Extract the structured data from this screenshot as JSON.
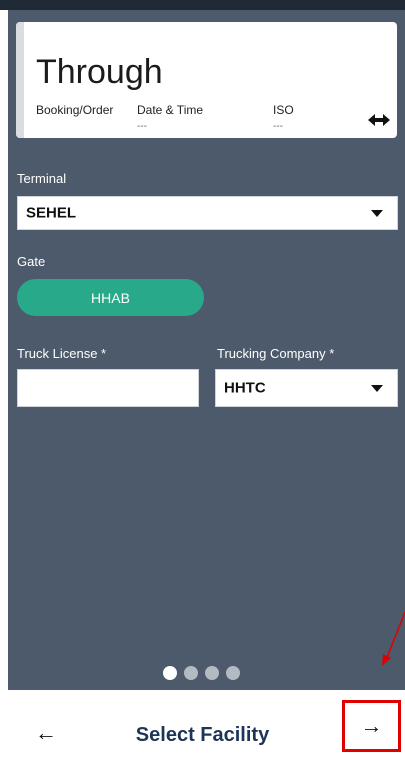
{
  "card": {
    "title": "Through",
    "columns": [
      {
        "label": "Booking/Order",
        "value": ""
      },
      {
        "label": "Date & Time",
        "value": "---"
      },
      {
        "label": "ISO",
        "value": "---"
      }
    ],
    "swap_icon": "left-right-arrow-icon"
  },
  "terminal": {
    "label": "Terminal",
    "value": "SEHEL"
  },
  "gate": {
    "label": "Gate",
    "value": "HHAB"
  },
  "truck_license": {
    "label": "Truck License *",
    "value": ""
  },
  "trucking_company": {
    "label": "Trucking Company *",
    "value": "HHTC"
  },
  "pagination": {
    "total": 4,
    "active": 1
  },
  "footer": {
    "back_glyph": "←",
    "title": "Select Facility",
    "next_glyph": "→"
  },
  "colors": {
    "background": "#4c5a6b",
    "accent": "#27a98a",
    "title_text": "#1d3557",
    "highlight": "#e00000"
  }
}
